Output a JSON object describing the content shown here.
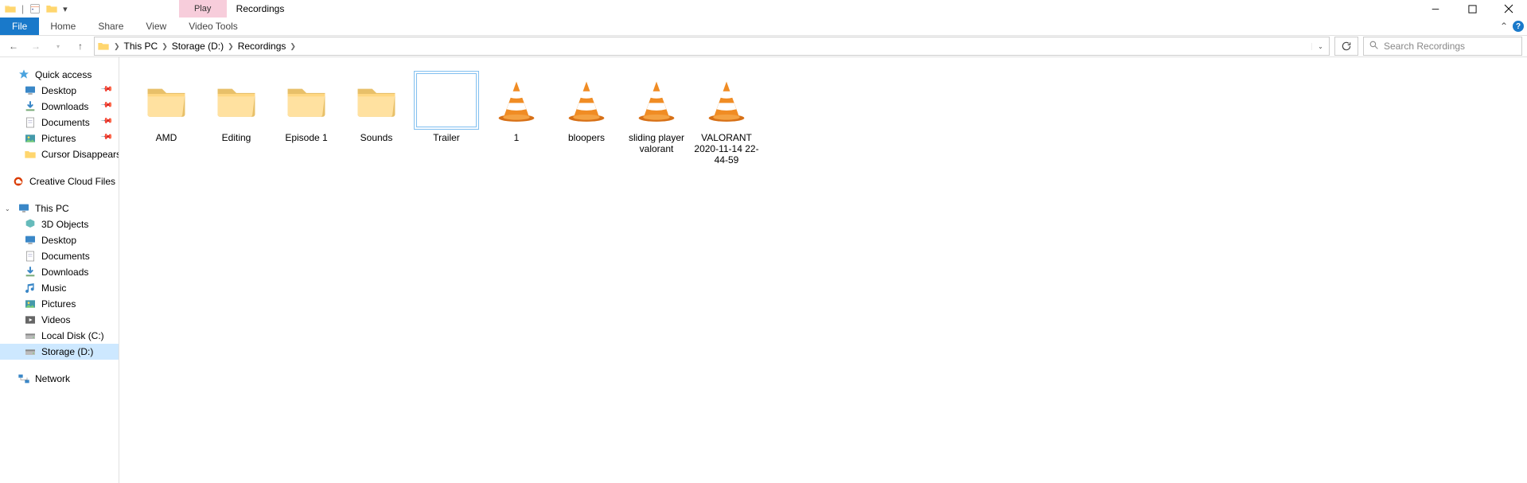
{
  "window": {
    "title": "Recordings",
    "context_tab": "Play"
  },
  "ribbon_tabs": {
    "file": "File",
    "home": "Home",
    "share": "Share",
    "view": "View",
    "video_tools": "Video Tools"
  },
  "breadcrumb": {
    "items": [
      "This PC",
      "Storage (D:)",
      "Recordings"
    ]
  },
  "search": {
    "placeholder": "Search Recordings"
  },
  "sidebar": {
    "quick_access": {
      "label": "Quick access",
      "items": [
        {
          "label": "Desktop",
          "pinned": true,
          "icon": "desktop"
        },
        {
          "label": "Downloads",
          "pinned": true,
          "icon": "downloads"
        },
        {
          "label": "Documents",
          "pinned": true,
          "icon": "documents"
        },
        {
          "label": "Pictures",
          "pinned": true,
          "icon": "pictures"
        },
        {
          "label": "Cursor Disappears on Ma",
          "pinned": false,
          "icon": "folder"
        }
      ]
    },
    "creative_cloud": {
      "label": "Creative Cloud Files"
    },
    "this_pc": {
      "label": "This PC",
      "items": [
        {
          "label": "3D Objects",
          "icon": "3d"
        },
        {
          "label": "Desktop",
          "icon": "desktop"
        },
        {
          "label": "Documents",
          "icon": "documents"
        },
        {
          "label": "Downloads",
          "icon": "downloads"
        },
        {
          "label": "Music",
          "icon": "music"
        },
        {
          "label": "Pictures",
          "icon": "pictures"
        },
        {
          "label": "Videos",
          "icon": "videos"
        },
        {
          "label": "Local Disk (C:)",
          "icon": "disk"
        },
        {
          "label": "Storage (D:)",
          "icon": "disk",
          "selected": true
        }
      ]
    },
    "network": {
      "label": "Network"
    }
  },
  "files": [
    {
      "name": "AMD",
      "type": "folder"
    },
    {
      "name": "Editing",
      "type": "folder"
    },
    {
      "name": "Episode 1",
      "type": "folder"
    },
    {
      "name": "Sounds",
      "type": "folder"
    },
    {
      "name": "Trailer",
      "type": "blank",
      "selected": true
    },
    {
      "name": "1",
      "type": "vlc"
    },
    {
      "name": "bloopers",
      "type": "vlc"
    },
    {
      "name": "sliding player valorant",
      "type": "vlc"
    },
    {
      "name": "VALORANT 2020-11-14 22-44-59",
      "type": "vlc"
    }
  ]
}
